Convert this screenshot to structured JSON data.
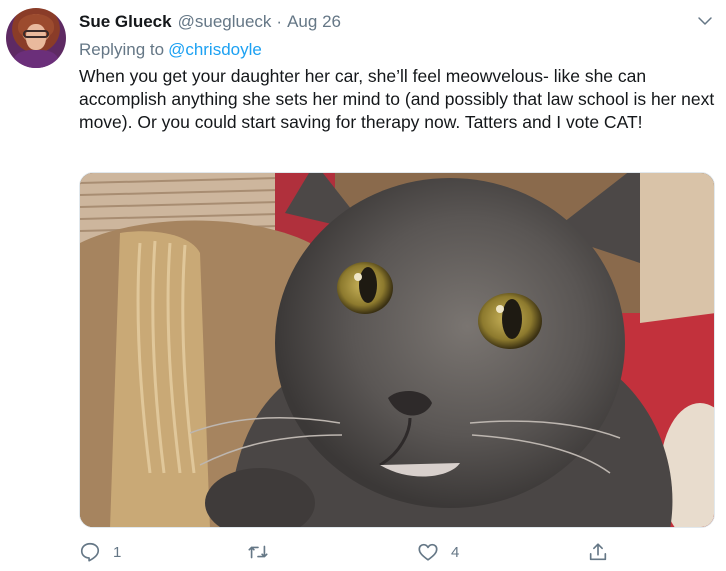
{
  "tweet": {
    "author_name": "Sue Glueck",
    "author_handle": "@sueglueck",
    "separator": "·",
    "date": "Aug 26",
    "replying_to_prefix": "Replying to",
    "replying_to_handle": "@chrisdoyle",
    "text": "When you get your daughter her car, she’ll feel meowvelous- like she can accomplish anything she sets her mind to (and possibly that law school is her next move). Or you could start saving for therapy now. Tatters and I vote CAT!"
  },
  "actions": {
    "reply_count": "1",
    "retweet_count": "",
    "like_count": "4"
  },
  "icons": {
    "chevron": "chevron-down-icon",
    "reply": "reply-icon",
    "retweet": "retweet-icon",
    "like": "heart-icon",
    "share": "share-icon"
  },
  "colors": {
    "link": "#1da1f2",
    "secondary_text": "#657786",
    "primary_text": "#14171a"
  }
}
